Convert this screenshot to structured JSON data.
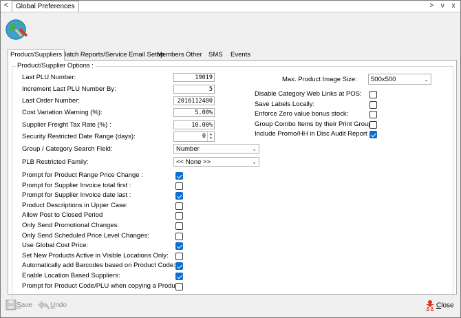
{
  "window": {
    "title": "Global Preferences",
    "back_glyph": "<",
    "controls": [
      ">",
      "v",
      "x"
    ]
  },
  "tabs": [
    "Product/Suppliers",
    "Batch Reports/Service Email Setup",
    "Members",
    "Other",
    "SMS",
    "Events"
  ],
  "group_title": "Product/Supplier Options :",
  "fields": {
    "last_plu": {
      "label": "Last PLU Number:",
      "value": "19019"
    },
    "inc_plu": {
      "label": "Increment Last PLU Number By:",
      "value": "5"
    },
    "last_order": {
      "label": "Last Order Number:",
      "value": "2016112480"
    },
    "cost_var": {
      "label": "Cost Variation Warning (%):",
      "value": "5.00%"
    },
    "freight": {
      "label": "Supplier Freight Tax Rate (%) :",
      "value": "10.00%"
    },
    "security_days": {
      "label": "Security Restricted Date Range (days):",
      "value": "0"
    },
    "search_field": {
      "label": "Group / Category Search Field:",
      "value": "Number"
    },
    "plb_family": {
      "label": "PLB Restricted Family:",
      "value": "<< None >>"
    },
    "image_size": {
      "label": "Max. Product Image Size:",
      "value": "500x500"
    }
  },
  "left_checks": [
    {
      "label": "Prompt for Product Range Price Change :",
      "checked": true
    },
    {
      "label": "Prompt for Supplier Invoice total first :",
      "checked": false
    },
    {
      "label": "Prompt for Supplier Invoice date last :",
      "checked": true
    },
    {
      "label": "Product Descriptions in Upper Case:",
      "checked": false
    },
    {
      "label": "Allow Post to Closed Period",
      "checked": false
    },
    {
      "label": "Only Send Promotional Changes:",
      "checked": false
    },
    {
      "label": "Only Send Scheduled Price Level Changes:",
      "checked": false
    },
    {
      "label": "Use Global Cost Price:",
      "checked": true
    },
    {
      "label": "Set New Products Active in Visible Locations Only:",
      "checked": false
    },
    {
      "label": "Automatically add Barcodes based on Product Code:",
      "checked": true
    },
    {
      "label": "Enable Location Based Suppliers:",
      "checked": true
    },
    {
      "label": "Prompt for Product Code/PLU when copying a Product",
      "checked": false
    }
  ],
  "right_checks": [
    {
      "label": "Disable Category Web Links at POS:",
      "checked": false
    },
    {
      "label": "Save Labels Locally:",
      "checked": false
    },
    {
      "label": "Enforce Zero value bonus stock:",
      "checked": false
    },
    {
      "label": "Group Combo Items by their Print Group",
      "checked": false
    },
    {
      "label": "Include Promo/HH in Disc Audit Report",
      "checked": true
    }
  ],
  "buttons": {
    "save": {
      "prefix": "S",
      "rest": "ave"
    },
    "undo": {
      "prefix": "U",
      "rest": "ndo"
    },
    "close": {
      "prefix": "C",
      "rest": "lose"
    }
  },
  "colors": {
    "checkbox_checked": "#0b6ed3",
    "close_icon": "#d9331a"
  },
  "icons": [
    "globe-tools-icon",
    "floppy-disk-icon",
    "undo-arrow-icon",
    "close-figure-icon"
  ]
}
